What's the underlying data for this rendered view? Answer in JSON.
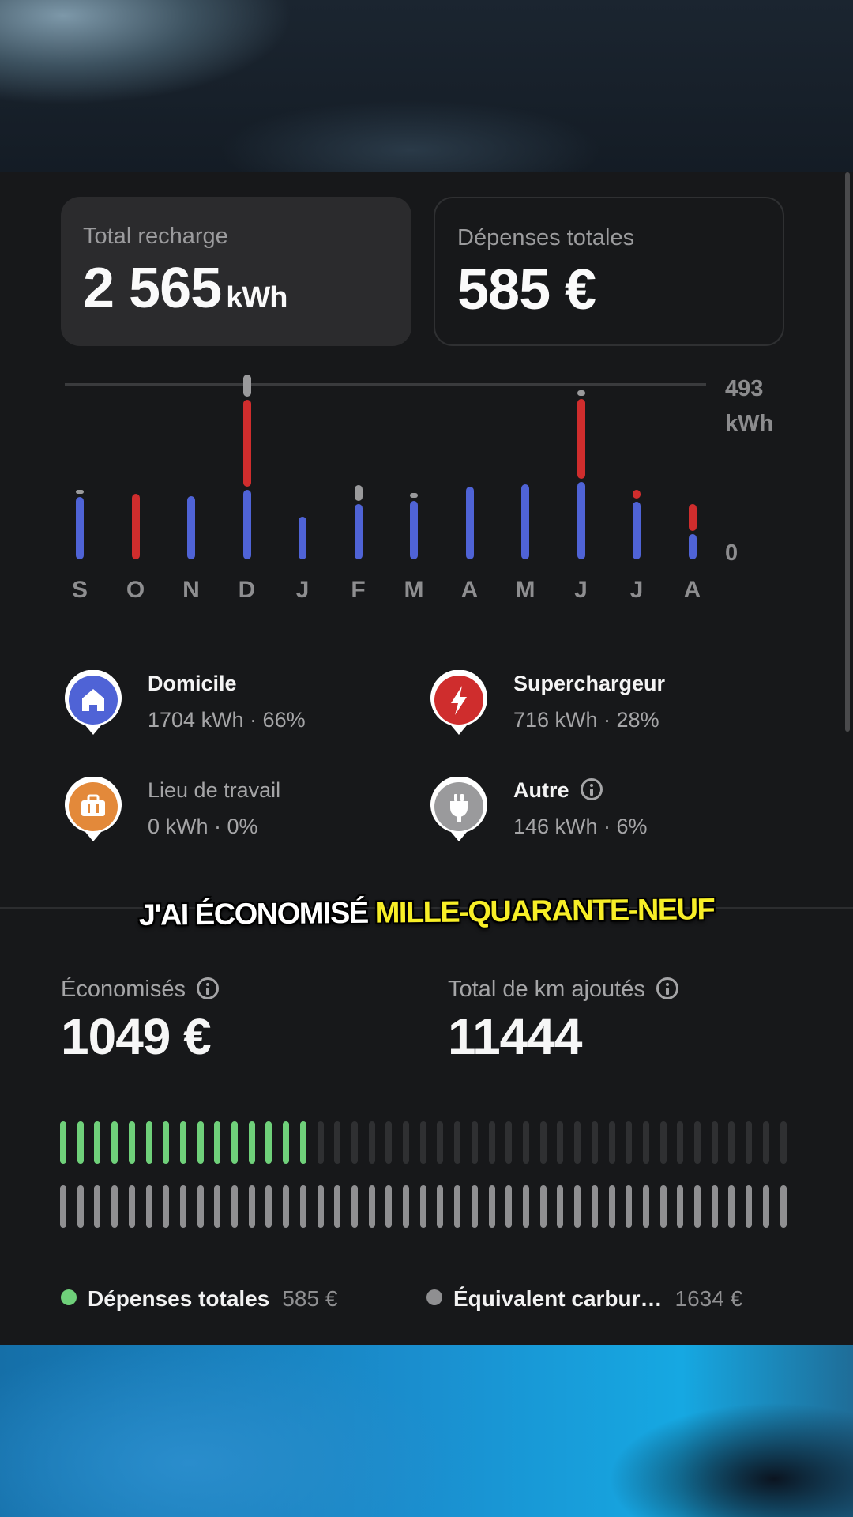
{
  "colors": {
    "home": "#4f63d6",
    "supercharger": "#cf2d2d",
    "other": "#9a9a9c",
    "saved": "#6fd07a",
    "workplace": "#e3893a"
  },
  "summary": {
    "total_charge_label": "Total recharge",
    "total_charge_value": "2 565",
    "total_charge_unit": "kWh",
    "total_spend_label": "Dépenses totales",
    "total_spend_value": "585 €"
  },
  "chart_data": {
    "type": "bar",
    "stacked": true,
    "categories": [
      "S",
      "O",
      "N",
      "D",
      "J",
      "F",
      "M",
      "A",
      "M",
      "J",
      "J",
      "A"
    ],
    "series": [
      {
        "color": "#4f63d6",
        "values": [
          175,
          0,
          178,
          195,
          120,
          155,
          165,
          205,
          212,
          218,
          162,
          72
        ]
      },
      {
        "color": "#cf2d2d",
        "values": [
          0,
          185,
          0,
          245,
          0,
          0,
          0,
          0,
          0,
          225,
          25,
          75
        ]
      },
      {
        "color": "#9a9a9c",
        "values": [
          12,
          0,
          0,
          62,
          0,
          45,
          12,
          0,
          0,
          15,
          0,
          0
        ]
      }
    ],
    "y_max_label": "493",
    "y_unit_label": "kWh",
    "y_min_label": "0",
    "ylim": [
      0,
      493
    ]
  },
  "locations": [
    {
      "name": "Domicile",
      "detail": "1704 kWh · 66%",
      "icon": "house-icon",
      "color": "#4f63d6"
    },
    {
      "name": "Superchargeur",
      "detail": "716 kWh · 28%",
      "icon": "lightning-icon",
      "color": "#c8243e"
    },
    {
      "name": "Lieu de travail",
      "detail": "0 kWh · 0%",
      "icon": "briefcase-icon",
      "color": "#e3893a"
    },
    {
      "name": "Autre",
      "detail": "146 kWh · 6%",
      "icon": "plug-icon",
      "color": "#8e8e90"
    }
  ],
  "caption": {
    "white": "J'AI ÉCONOMISÉ",
    "yellow": "MILLE-QUARANTE-NEUF"
  },
  "savings": {
    "saved_label": "Économisés",
    "saved_value": "1049 €",
    "km_label": "Total de km ajoutés",
    "km_value": "11444"
  },
  "comparison": {
    "spend_fraction": 0.358,
    "fuel_fraction": 1.0
  },
  "legend": {
    "spend_label": "Dépenses totales",
    "spend_value": "585 €",
    "fuel_label": "Équivalent carbur…",
    "fuel_value": "1634 €"
  }
}
